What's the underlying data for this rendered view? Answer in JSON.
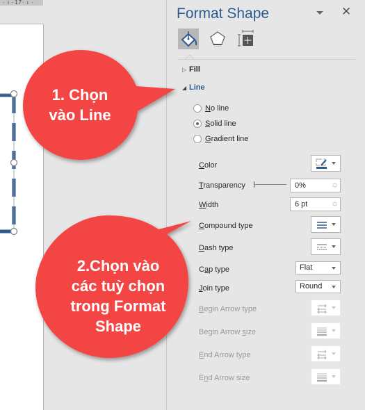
{
  "ruler": {
    "label": "· ı ·17· ı ·"
  },
  "pane": {
    "title": "Format Shape",
    "tabs": [
      {
        "name": "fill-line",
        "icon": "paint-bucket-icon",
        "active": true
      },
      {
        "name": "effects",
        "icon": "pentagon-icon",
        "active": false
      },
      {
        "name": "size-properties",
        "icon": "size-position-icon",
        "active": false
      }
    ],
    "sections": {
      "fill": {
        "label": "Fill",
        "expanded": false
      },
      "line": {
        "label": "Line",
        "expanded": true
      }
    },
    "line_options": [
      {
        "label": "No line",
        "accel": "N",
        "rest": "o line",
        "checked": false
      },
      {
        "label": "Solid line",
        "accel": "S",
        "rest": "olid line",
        "checked": true
      },
      {
        "label": "Gradient line",
        "accel": "G",
        "rest": "radient line",
        "checked": false
      }
    ],
    "properties": {
      "color": {
        "accel": "C",
        "rest": "olor",
        "swatch": "#2e5b8f"
      },
      "transparency": {
        "accel": "T",
        "rest": "ransparency",
        "value": "0%",
        "slider_fraction": 0
      },
      "width": {
        "accel": "W",
        "rest": "idth",
        "value": "6 pt"
      },
      "compound_type": {
        "accel": "C",
        "rest": "ompound type"
      },
      "dash_type": {
        "accel": "D",
        "rest": "ash type"
      },
      "cap_type": {
        "pre": "C",
        "accel": "a",
        "rest": "p type",
        "value": "Flat"
      },
      "join_type": {
        "accel": "J",
        "rest": "oin type",
        "value": "Round"
      },
      "begin_arrow_type": {
        "accel": "B",
        "rest": "egin Arrow type",
        "disabled": true
      },
      "begin_arrow_size": {
        "pre": "Begin Arrow ",
        "accel": "s",
        "rest": "ize",
        "disabled": true
      },
      "end_arrow_type": {
        "accel": "E",
        "rest": "nd Arrow type",
        "disabled": true
      },
      "end_arrow_size": {
        "pre": "E",
        "accel": "n",
        "rest": "d Arrow size",
        "disabled": true
      }
    }
  },
  "callouts": [
    {
      "text_lines": [
        "1. Chọn",
        "vào Line"
      ]
    },
    {
      "text_lines": [
        "2.Chọn vào",
        "các tuỳ chọn",
        "trong Format",
        "Shape"
      ]
    }
  ],
  "colors": {
    "accent": "#2e5b8f",
    "callout": "#f44444",
    "pane_bg": "#e6e6e6"
  }
}
